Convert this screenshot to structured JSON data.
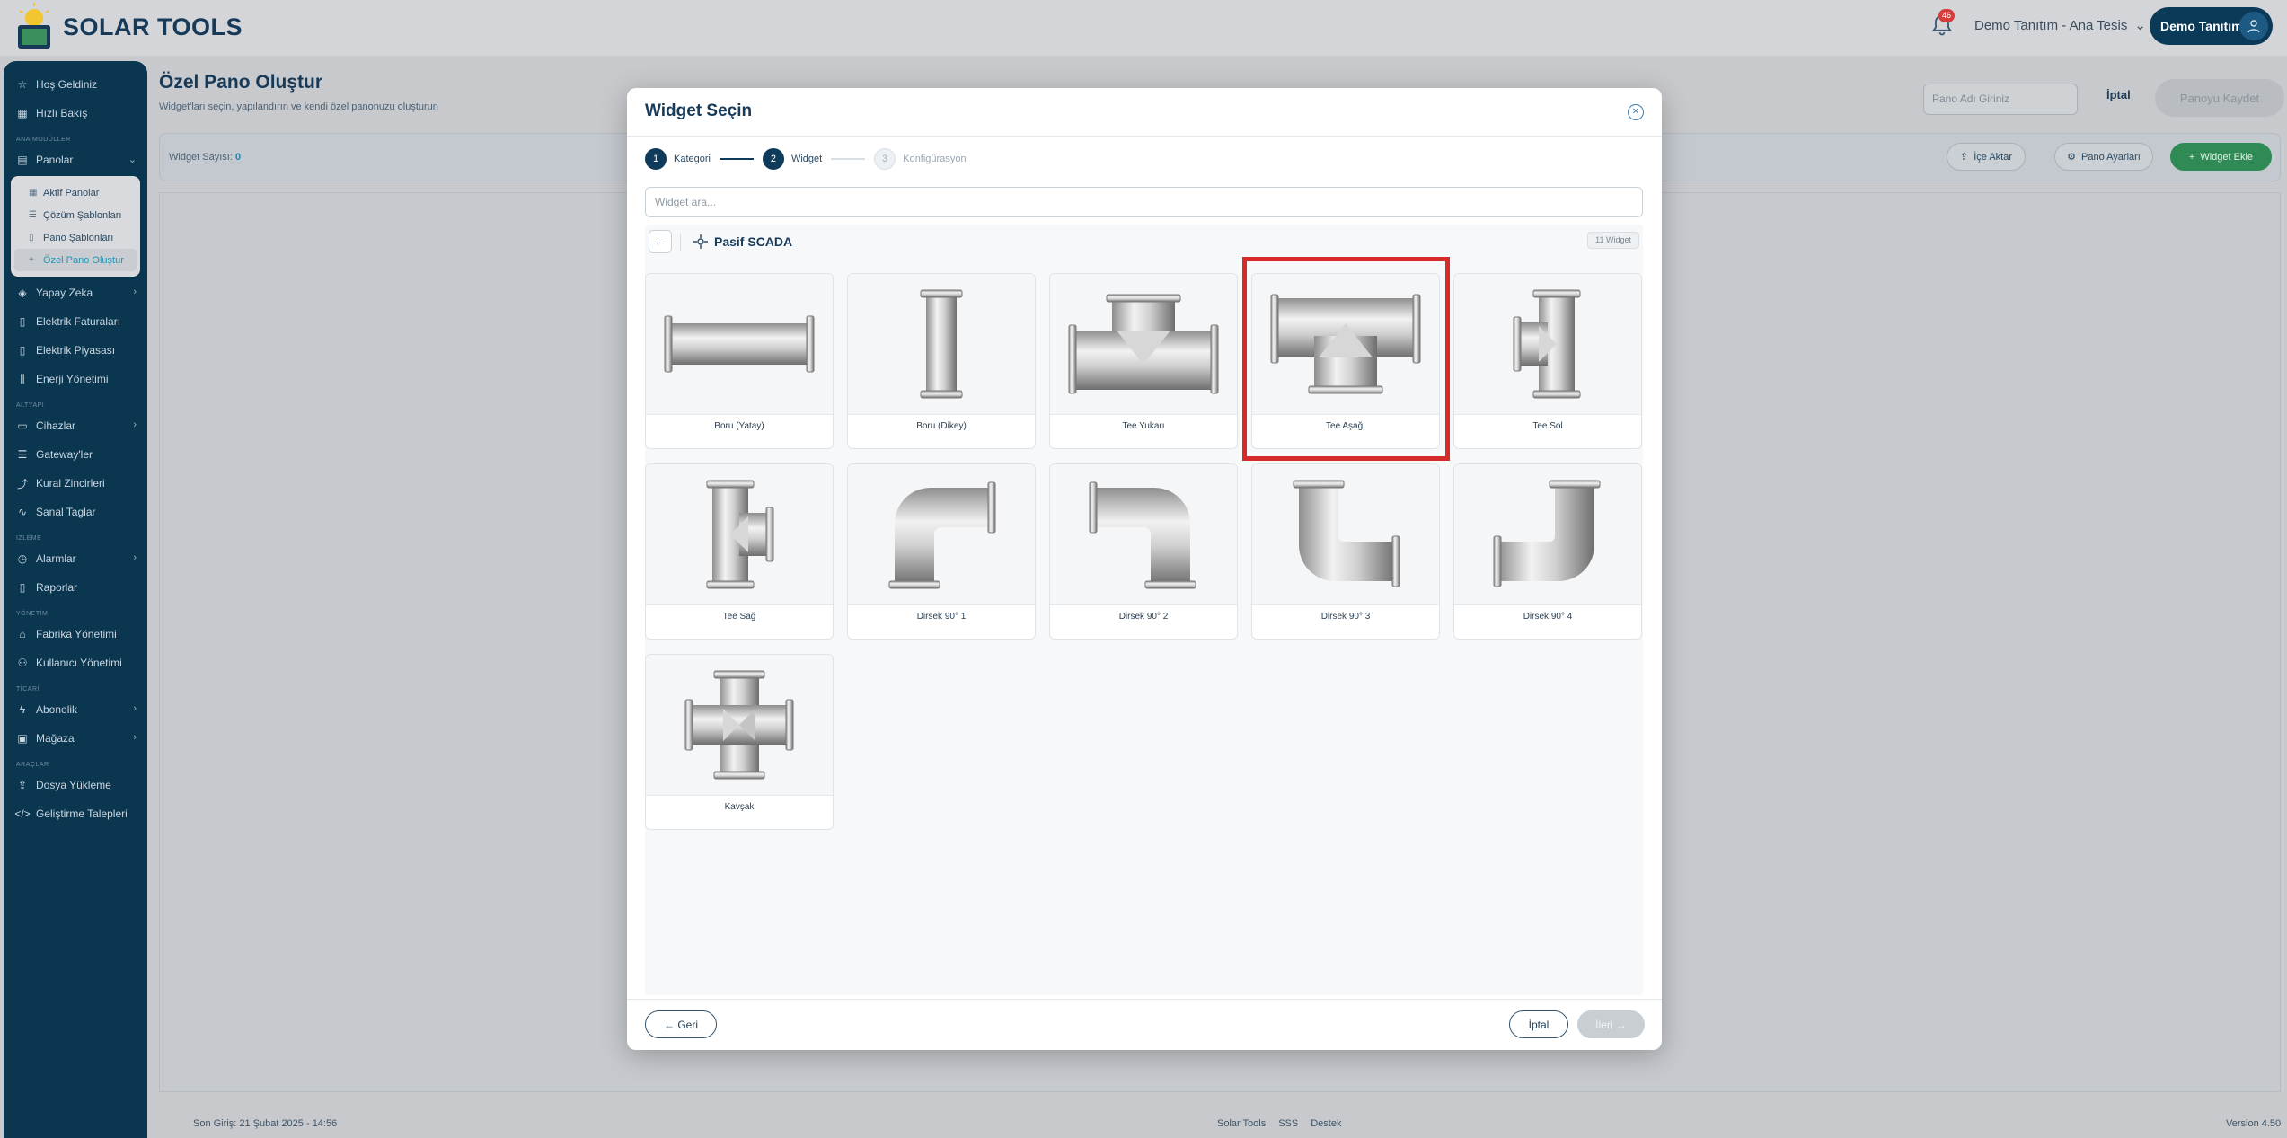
{
  "app": {
    "brand": "SOLAR TOOLS"
  },
  "header": {
    "notification_count": "46",
    "tenant": "Demo Tanıtım - Ana Tesis",
    "user": "Demo Tanıtım"
  },
  "sidebar": {
    "items_top": [
      {
        "label": "Hoş Geldiniz",
        "icon": "star-icon"
      },
      {
        "label": "Hızlı Bakış",
        "icon": "grid-icon"
      }
    ],
    "section_main": "ANA MODÜLLER",
    "panolar": {
      "label": "Panolar"
    },
    "panolar_sub": [
      {
        "label": "Aktif Panolar"
      },
      {
        "label": "Çözüm Şablonları"
      },
      {
        "label": "Pano Şablonları"
      },
      {
        "label": "Özel Pano Oluştur"
      }
    ],
    "items_main": [
      {
        "label": "Yapay Zeka"
      },
      {
        "label": "Elektrik Faturaları"
      },
      {
        "label": "Elektrik Piyasası"
      },
      {
        "label": "Enerji Yönetimi"
      }
    ],
    "section_infra": "ALTYAPI",
    "items_infra": [
      {
        "label": "Cihazlar"
      },
      {
        "label": "Gateway'ler"
      },
      {
        "label": "Kural Zincirleri"
      },
      {
        "label": "Sanal Taglar"
      }
    ],
    "section_monitor": "İZLEME",
    "items_monitor": [
      {
        "label": "Alarmlar"
      },
      {
        "label": "Raporlar"
      }
    ],
    "section_admin": "YÖNETİM",
    "items_admin": [
      {
        "label": "Fabrika Yönetimi"
      },
      {
        "label": "Kullanıcı Yönetimi"
      }
    ],
    "section_trade": "TİCARİ",
    "items_trade": [
      {
        "label": "Abonelik"
      },
      {
        "label": "Mağaza"
      }
    ],
    "section_tools": "ARAÇLAR",
    "items_tools": [
      {
        "label": "Dosya Yükleme"
      },
      {
        "label": "Geliştirme Talepleri"
      }
    ]
  },
  "page": {
    "title": "Özel Pano Oluştur",
    "subtitle": "Widget'ları seçin, yapılandırın ve kendi özel panonuzu oluşturun",
    "name_placeholder": "Pano Adı Giriniz",
    "cancel": "İptal",
    "save": "Panoyu Kaydet",
    "widget_count_label": "Widget Sayısı:",
    "widget_count": "0",
    "import": "İçe Aktar",
    "settings": "Pano Ayarları",
    "add_widget": "Widget Ekle"
  },
  "footer": {
    "last_login": "Son Giriş: 21 Şubat 2025 - 14:56",
    "links": [
      "Solar Tools",
      "SSS",
      "Destek"
    ],
    "version": "Version 4.50"
  },
  "modal": {
    "title": "Widget Seçin",
    "steps": [
      {
        "num": "1",
        "label": "Kategori"
      },
      {
        "num": "2",
        "label": "Widget"
      },
      {
        "num": "3",
        "label": "Konfigürasyon"
      }
    ],
    "search_placeholder": "Widget ara...",
    "category": "Pasif SCADA",
    "category_count": "11 Widget",
    "widgets": [
      {
        "label": "Boru (Yatay)",
        "icon": "pipe-horizontal-icon"
      },
      {
        "label": "Boru (Dikey)",
        "icon": "pipe-vertical-icon"
      },
      {
        "label": "Tee Yukarı",
        "icon": "tee-up-icon"
      },
      {
        "label": "Tee Aşağı",
        "icon": "tee-down-icon"
      },
      {
        "label": "Tee Sol",
        "icon": "tee-left-icon"
      },
      {
        "label": "Tee Sağ",
        "icon": "tee-right-icon"
      },
      {
        "label": "Dirsek 90° 1",
        "icon": "elbow-1-icon"
      },
      {
        "label": "Dirsek 90° 2",
        "icon": "elbow-2-icon"
      },
      {
        "label": "Dirsek 90° 3",
        "icon": "elbow-3-icon"
      },
      {
        "label": "Dirsek 90° 4",
        "icon": "elbow-4-icon"
      },
      {
        "label": "Kavşak",
        "icon": "cross-icon"
      }
    ],
    "back": "← Geri",
    "cancel": "İptal",
    "next": "İleri →"
  }
}
